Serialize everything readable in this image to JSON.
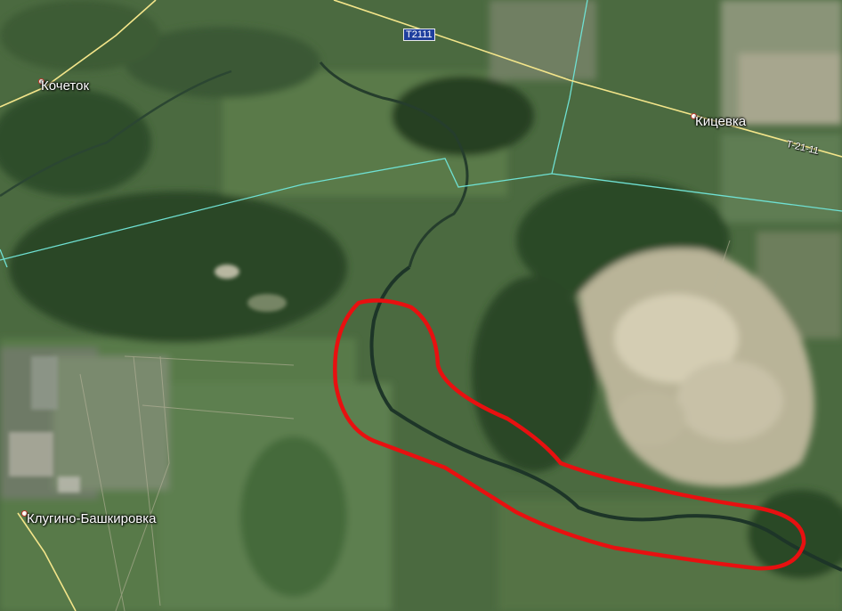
{
  "places": [
    {
      "id": "kochetok",
      "name": "Кочеток"
    },
    {
      "id": "kitsevka",
      "name": "Кицевка"
    },
    {
      "id": "klugino",
      "name": "Клугино-Башкировка"
    }
  ],
  "roads": {
    "shield_label": "T2111",
    "highway_label": "T-21-11"
  },
  "colors": {
    "highlight": "#e81010",
    "road": "#f3e58a",
    "border": "#6fe0d2",
    "river": "#1d3528",
    "forest": "#223c22",
    "sand": "#d7d0b8"
  }
}
